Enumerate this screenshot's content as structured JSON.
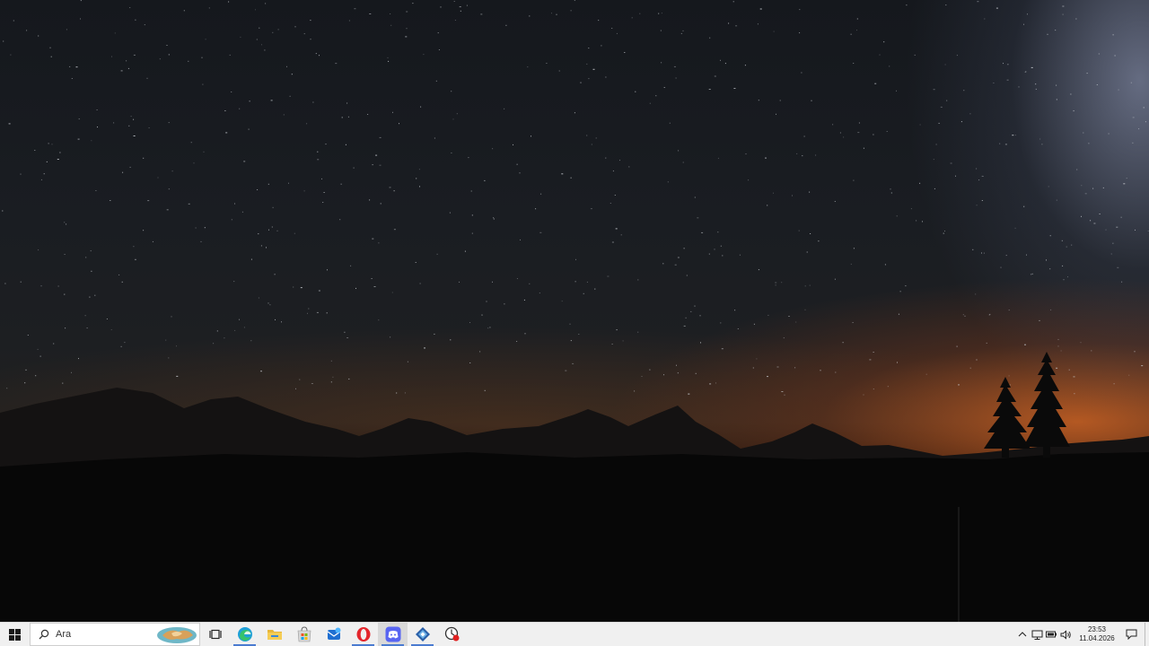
{
  "taskbar": {
    "search": {
      "placeholder": "Ara"
    },
    "pinned_apps": [
      {
        "name": "task-view",
        "icon": "task-view-icon"
      },
      {
        "name": "edge",
        "icon": "edge-icon",
        "running": true
      },
      {
        "name": "file-explorer",
        "icon": "folder-icon"
      },
      {
        "name": "microsoft-store",
        "icon": "store-icon"
      },
      {
        "name": "mail",
        "icon": "mail-icon"
      },
      {
        "name": "opera",
        "icon": "opera-icon",
        "running": true
      },
      {
        "name": "discord",
        "icon": "discord-icon",
        "running": true,
        "active": true
      },
      {
        "name": "app-diamond",
        "icon": "diamond-app-icon",
        "running": true
      },
      {
        "name": "app-record",
        "icon": "record-app-icon"
      }
    ],
    "tray": {
      "time": "23:53",
      "date": "11.04.2026"
    }
  },
  "colors": {
    "taskbar_bg": "#f0f0f0",
    "running_indicator": "#4a7bd0",
    "sky_top": "#15181d",
    "horizon_glow": "#cd6223"
  }
}
